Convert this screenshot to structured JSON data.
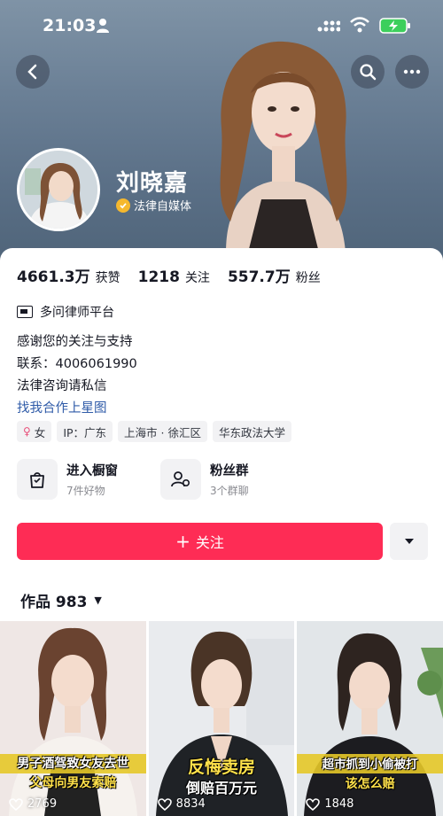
{
  "status_bar": {
    "time": "21:03"
  },
  "profile": {
    "name": "刘晓嘉",
    "verified_label": "法律自媒体"
  },
  "stats": [
    {
      "value": "4661.3万",
      "label": "获赞"
    },
    {
      "value": "1218",
      "label": "关注"
    },
    {
      "value": "557.7万",
      "label": "粉丝"
    }
  ],
  "organization": "多问律师平台",
  "bio": {
    "line1": "感谢您的关注与支持",
    "line2": "联系：4006061990",
    "line3": "法律咨询请私信",
    "link": "找我合作上星图"
  },
  "tags": {
    "gender": "女",
    "ip": "IP：广东",
    "location": "上海市 · 徐汇区",
    "school": "华东政法大学"
  },
  "features": {
    "shop": {
      "title": "进入橱窗",
      "sub": "7件好物"
    },
    "fans_group": {
      "title": "粉丝群",
      "sub": "3个群聊"
    }
  },
  "follow_button": {
    "plus": "+",
    "label": "关注"
  },
  "works_tab": {
    "label": "作品 983"
  },
  "videos": [
    {
      "caption_line1": "男子酒驾致女友去世",
      "caption_line2": "父母向男友索赔",
      "likes": "2769"
    },
    {
      "caption_line1": "反悔卖房",
      "caption_line2": "倒赔百万元",
      "likes": "8834"
    },
    {
      "caption_line1": "超市抓到小偷被打",
      "caption_line2": "该怎么赔",
      "likes": "1848"
    }
  ],
  "colors": {
    "accent": "#fe2c55",
    "banner": "#6b8096",
    "link": "#2f5ba8",
    "verified": "#f5b82e"
  }
}
